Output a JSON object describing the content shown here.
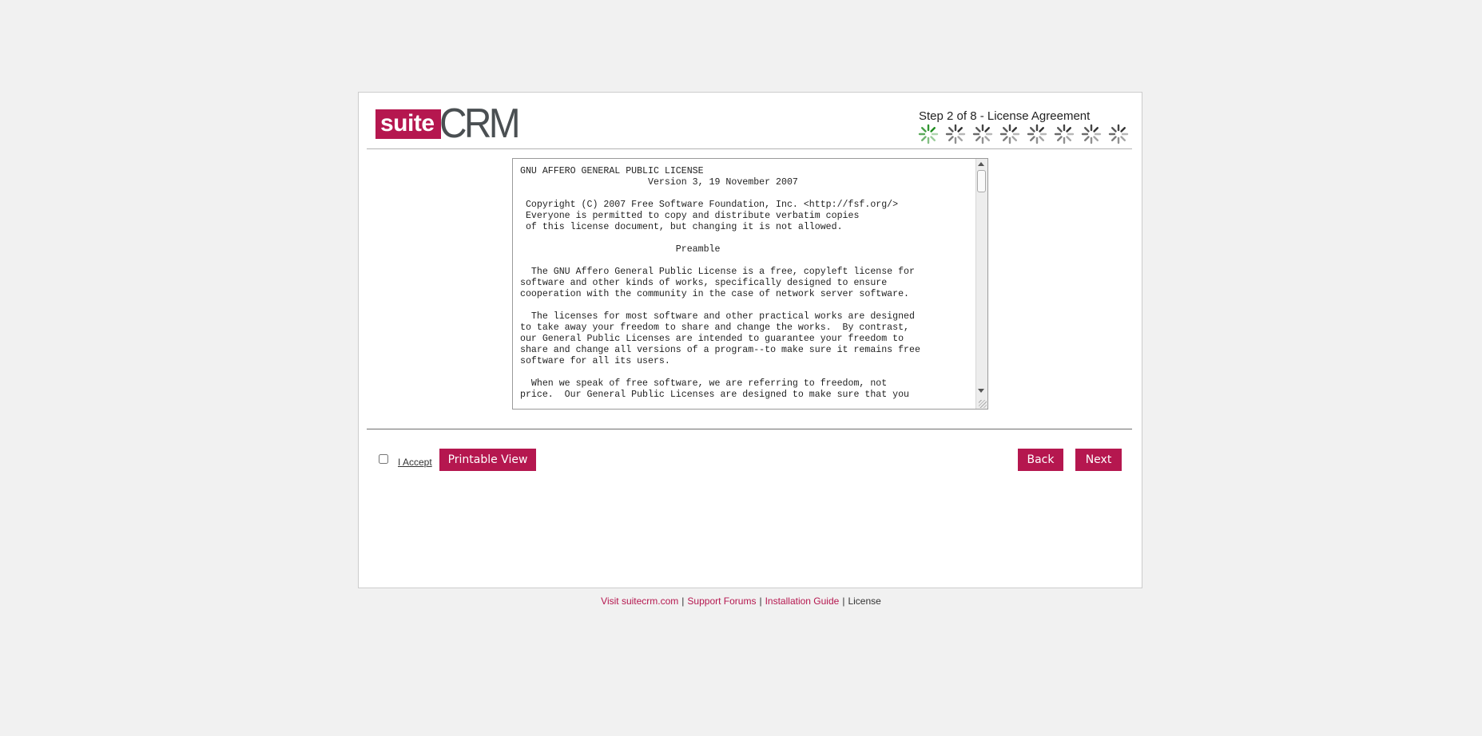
{
  "header": {
    "logo_suite": "suite",
    "logo_crm": "CRM",
    "step_title": "Step 2 of 8 - License Agreement",
    "steps_total": 8,
    "steps_completed": 1
  },
  "license": {
    "text": "GNU AFFERO GENERAL PUBLIC LICENSE\n                       Version 3, 19 November 2007\n\n Copyright (C) 2007 Free Software Foundation, Inc. <http://fsf.org/>\n Everyone is permitted to copy and distribute verbatim copies\n of this license document, but changing it is not allowed.\n\n                            Preamble\n\n  The GNU Affero General Public License is a free, copyleft license for\nsoftware and other kinds of works, specifically designed to ensure\ncooperation with the community in the case of network server software.\n\n  The licenses for most software and other practical works are designed\nto take away your freedom to share and change the works.  By contrast,\nour General Public Licenses are intended to guarantee your freedom to\nshare and change all versions of a program--to make sure it remains free\nsoftware for all its users.\n\n  When we speak of free software, we are referring to freedom, not\nprice.  Our General Public Licenses are designed to make sure that you"
  },
  "actions": {
    "accept_label": "I Accept",
    "printable_view_label": "Printable View",
    "back_label": "Back",
    "next_label": "Next"
  },
  "footer": {
    "links": [
      {
        "label": "Visit suitecrm.com"
      },
      {
        "label": "Support Forums"
      },
      {
        "label": "Installation Guide"
      }
    ],
    "separator": "|",
    "license_label": "License"
  },
  "colors": {
    "accent": "#b5174f",
    "step_done": "#1e8c1e",
    "step_pending": "#333333"
  }
}
